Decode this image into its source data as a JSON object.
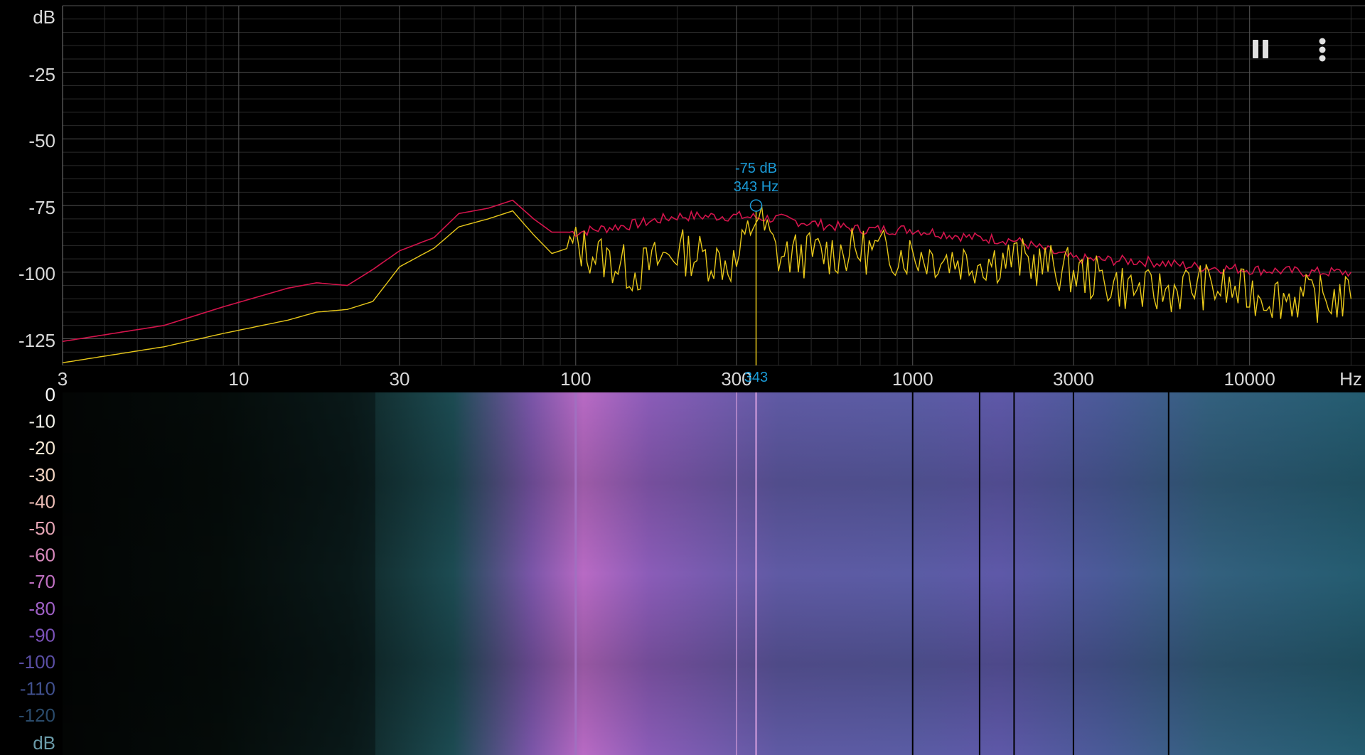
{
  "spectrum": {
    "y_unit_top": "dB",
    "y_ticks": [
      "-25",
      "-50",
      "-75",
      "-100",
      "-125"
    ],
    "x_ticks": [
      "3",
      "10",
      "30",
      "100",
      "300",
      "1000",
      "3000",
      "10000"
    ],
    "x_unit": "Hz",
    "cursor": {
      "db_label": "-75 dB",
      "hz_label": "343 Hz",
      "axis_label": "343"
    },
    "colors": {
      "peak_hold": "#d4144c",
      "live": "#e8c81a",
      "cursor": "#1a9ad6",
      "grid_major": "#555555",
      "grid_minor": "#2a2a2a"
    }
  },
  "spectrogram": {
    "scale_labels": [
      "0",
      "-10",
      "-20",
      "-30",
      "-40",
      "-50",
      "-60",
      "-70",
      "-80",
      "-90",
      "-100",
      "-110",
      "-120"
    ],
    "scale_unit": "dB",
    "scale_colors": [
      "#ffffff",
      "#f2f2ea",
      "#f4e6d2",
      "#f2d4c2",
      "#ecbdb6",
      "#e4a4b4",
      "#d688bb",
      "#c070c2",
      "#9f60c6",
      "#7b52b8",
      "#5a4ea4",
      "#40508e",
      "#2a4a6a"
    ]
  },
  "toolbar": {
    "pause_icon": "pause-icon",
    "menu_icon": "more-vert-icon"
  },
  "chart_data": {
    "type": "line",
    "xlabel": "Hz",
    "ylabel": "dB",
    "x_scale": "log",
    "xlim": [
      3,
      22000
    ],
    "ylim": [
      -135,
      0
    ],
    "grid": true,
    "series": [
      {
        "x": [
          3,
          6,
          9,
          14,
          17,
          21,
          25,
          30,
          38,
          45,
          55,
          65,
          75,
          85,
          100,
          150,
          200,
          300,
          400,
          700,
          1000,
          1500,
          2000,
          3000,
          5000,
          7000,
          10000,
          15000,
          20000
        ],
        "values": [
          -126,
          -120,
          -113,
          -106,
          -104,
          -105,
          -99,
          -92,
          -87,
          -78,
          -76,
          -73,
          -80,
          -85,
          -85,
          -82,
          -79,
          -79,
          -80,
          -84,
          -84,
          -87,
          -88,
          -95,
          -96,
          -98,
          -99,
          -100,
          -100
        ]
      },
      {
        "x": [
          3,
          6,
          9,
          14,
          17,
          21,
          25,
          30,
          38,
          45,
          55,
          65,
          75,
          85,
          100,
          150,
          200,
          300,
          343,
          400,
          700,
          1000,
          1500,
          2000,
          3000,
          5000,
          7000,
          10000,
          15000,
          20000
        ],
        "values": [
          -134,
          -128,
          -123,
          -118,
          -115,
          -114,
          -111,
          -98,
          -91,
          -83,
          -80,
          -77,
          -86,
          -93,
          -90,
          -100,
          -92,
          -97,
          -78,
          -94,
          -92,
          -93,
          -96,
          -95,
          -100,
          -108,
          -105,
          -108,
          -110,
          -110
        ]
      }
    ]
  }
}
